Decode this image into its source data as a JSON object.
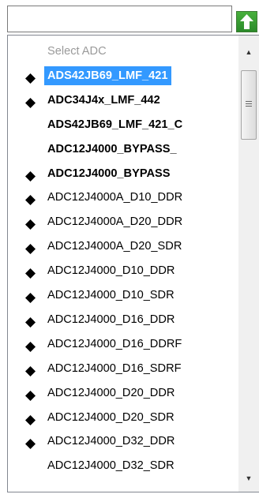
{
  "combo": {
    "value": "",
    "button_icon": "green-up-arrow-icon"
  },
  "list": {
    "items": [
      {
        "label": "Select ADC",
        "style": "placeholder",
        "bullet": false
      },
      {
        "label": "ADS42JB69_LMF_421",
        "style": "selected",
        "bullet": true
      },
      {
        "label": "ADC34J4x_LMF_442",
        "style": "bold",
        "bullet": true
      },
      {
        "label": "ADS42JB69_LMF_421_C",
        "style": "bold",
        "bullet": false
      },
      {
        "label": "ADC12J4000_BYPASS_",
        "style": "bold",
        "bullet": false
      },
      {
        "label": "ADC12J4000_BYPASS",
        "style": "bold",
        "bullet": true
      },
      {
        "label": "ADC12J4000A_D10_DDR",
        "style": "normal",
        "bullet": true
      },
      {
        "label": "ADC12J4000A_D20_DDR",
        "style": "normal",
        "bullet": true
      },
      {
        "label": "ADC12J4000A_D20_SDR",
        "style": "normal",
        "bullet": true
      },
      {
        "label": "ADC12J4000_D10_DDR",
        "style": "normal",
        "bullet": true
      },
      {
        "label": "ADC12J4000_D10_SDR",
        "style": "normal",
        "bullet": true
      },
      {
        "label": "ADC12J4000_D16_DDR",
        "style": "normal",
        "bullet": true
      },
      {
        "label": "ADC12J4000_D16_DDRF",
        "style": "normal",
        "bullet": true
      },
      {
        "label": "ADC12J4000_D16_SDRF",
        "style": "normal",
        "bullet": true
      },
      {
        "label": "ADC12J4000_D20_DDR",
        "style": "normal",
        "bullet": true
      },
      {
        "label": "ADC12J4000_D20_SDR",
        "style": "normal",
        "bullet": true
      },
      {
        "label": "ADC12J4000_D32_DDR",
        "style": "normal",
        "bullet": true
      },
      {
        "label": "ADC12J4000_D32_SDR",
        "style": "normal",
        "bullet": false
      }
    ]
  },
  "scrollbar": {
    "up_icon": "scroll-up-arrow-icon",
    "down_icon": "scroll-down-arrow-icon",
    "up_glyph": "▲",
    "down_glyph": "▼"
  },
  "colors": {
    "selection": "#3399ff",
    "placeholder": "#9a9a9a",
    "button_green": "#2b8a2a"
  }
}
